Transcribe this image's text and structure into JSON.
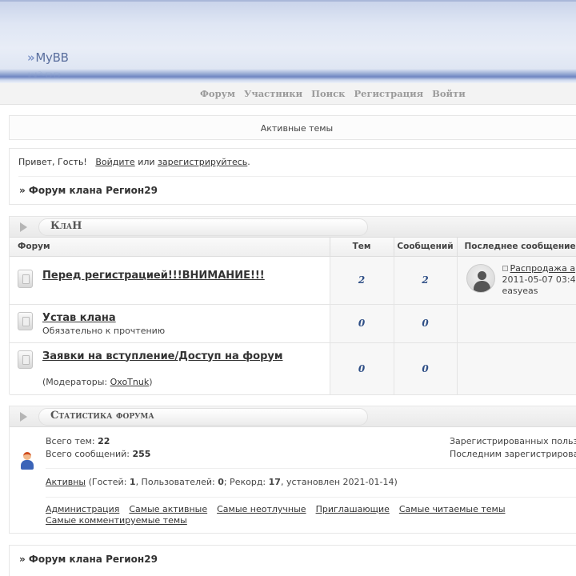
{
  "header": {
    "logo_text": "MyBB",
    "logo_chevron": "»"
  },
  "nav": {
    "items": [
      "Форум",
      "Участники",
      "Поиск",
      "Регистрация",
      "Войти"
    ]
  },
  "active_topics": {
    "label": "Активные темы"
  },
  "welcome": {
    "greeting": "Привет, Гость!",
    "login_link": "Войдите",
    "or_text": "или",
    "register_link": "зарегистрируйтесь",
    "period": ".",
    "breadcrumb": "» Форум клана Регион29"
  },
  "category": {
    "title": "КлаН",
    "columns": {
      "forum": "Форум",
      "topics": "Тем",
      "posts": "Сообщений",
      "last": "Последнее сообщение"
    },
    "forums": [
      {
        "name": "Перед регистрацией!!!ВНИМАНИЕ!!!",
        "description": "",
        "topics": "2",
        "posts": "2",
        "last_post": {
          "title": "Распродажа а",
          "date": "2011-05-07 03:4",
          "author": "easyeas"
        }
      },
      {
        "name": "Устав клана",
        "description": "Обязательно к прочтению",
        "topics": "0",
        "posts": "0"
      },
      {
        "name": "Заявки на вступление/Доступ на форум",
        "description": "(Модераторы: ",
        "moderator": "OxoTnuk",
        "description_end": ")",
        "topics": "0",
        "posts": "0"
      }
    ]
  },
  "stats": {
    "title": "Статистика форума",
    "total_topics_label": "Всего тем:",
    "total_topics": "22",
    "total_posts_label": "Всего сообщений:",
    "total_posts": "255",
    "registered_label": "Зарегистрированных польз",
    "last_registered_label": "Последним зарегистрирова",
    "online_link": "Активны",
    "online_text_1": " (Гостей: ",
    "guests": "1",
    "online_text_2": ", Пользователей: ",
    "users": "0",
    "online_text_3": "; Рекорд: ",
    "record": "17",
    "online_text_4": ", установлен 2021-01-14)",
    "links": [
      "Администрация",
      "Самые активные",
      "Самые неотлучные",
      "Приглашающие",
      "Самые читаемые темы",
      "Самые комментируемые темы"
    ]
  },
  "footer": {
    "breadcrumb": "» Форум клана Регион29"
  }
}
